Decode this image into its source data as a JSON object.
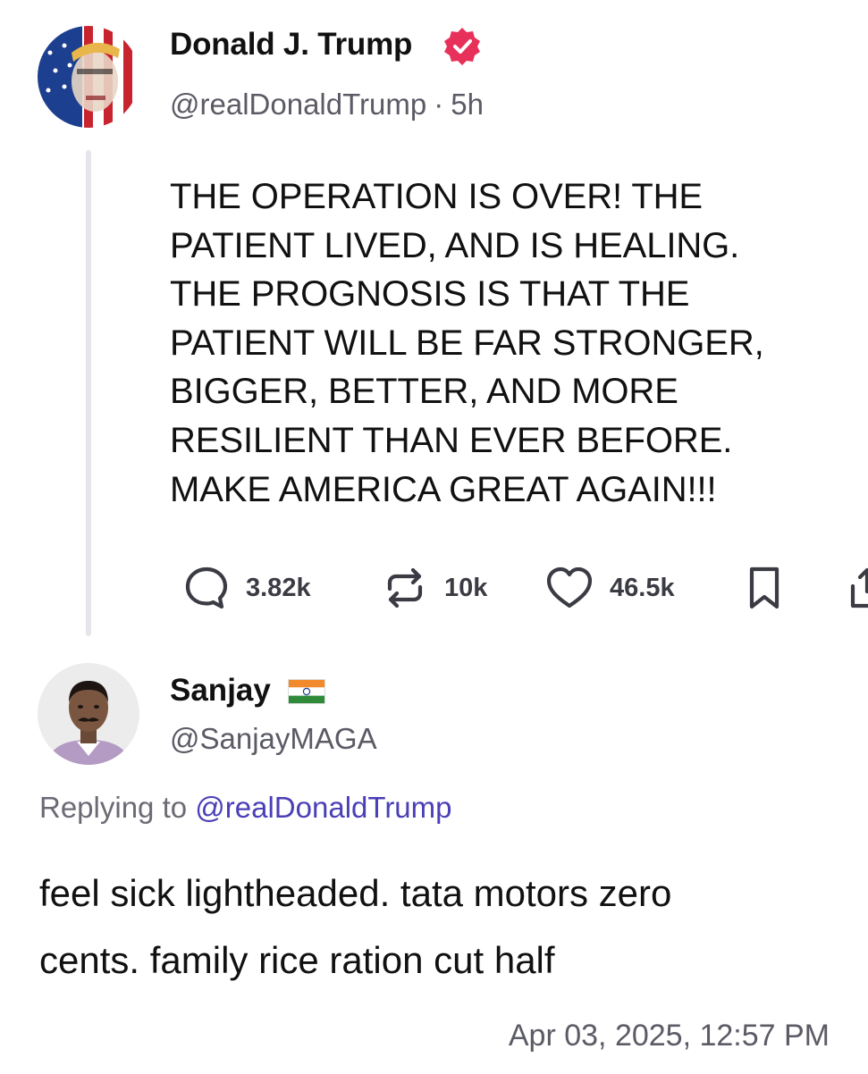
{
  "post": {
    "author_name": "Donald J. Trump",
    "verified_icon": "verified-badge-icon",
    "handle": "@realDonaldTrump",
    "separator": "·",
    "time_ago": "5h",
    "body": "THE OPERATION IS OVER! THE\nPATIENT LIVED, AND IS HEALING.\nTHE PROGNOSIS IS THAT THE\nPATIENT WILL BE FAR STRONGER,\nBIGGER, BETTER, AND MORE\nRESILIENT THAN EVER BEFORE.\nMAKE AMERICA GREAT AGAIN!!!",
    "actions": {
      "replies": "3.82k",
      "reposts": "10k",
      "likes": "46.5k",
      "reply_icon": "comment-icon",
      "repost_icon": "repost-icon",
      "like_icon": "heart-icon",
      "bookmark_icon": "bookmark-icon",
      "share_icon": "share-icon"
    }
  },
  "reply": {
    "author_name": "Sanjay",
    "flag_icon": "india-flag-icon",
    "handle": "@SanjayMAGA",
    "replying_label": "Replying to",
    "replying_to": "@realDonaldTrump",
    "body": "feel sick lightheaded. tata motors zero\ncents. family rice ration cut half",
    "timestamp": "Apr 03, 2025, 12:57 PM"
  },
  "colors": {
    "verified": "#e8315a",
    "mention": "#4b3fb8",
    "muted_text": "#5b5b66",
    "action_icon": "#3b3b44",
    "thread_line": "#e6e6ea"
  }
}
